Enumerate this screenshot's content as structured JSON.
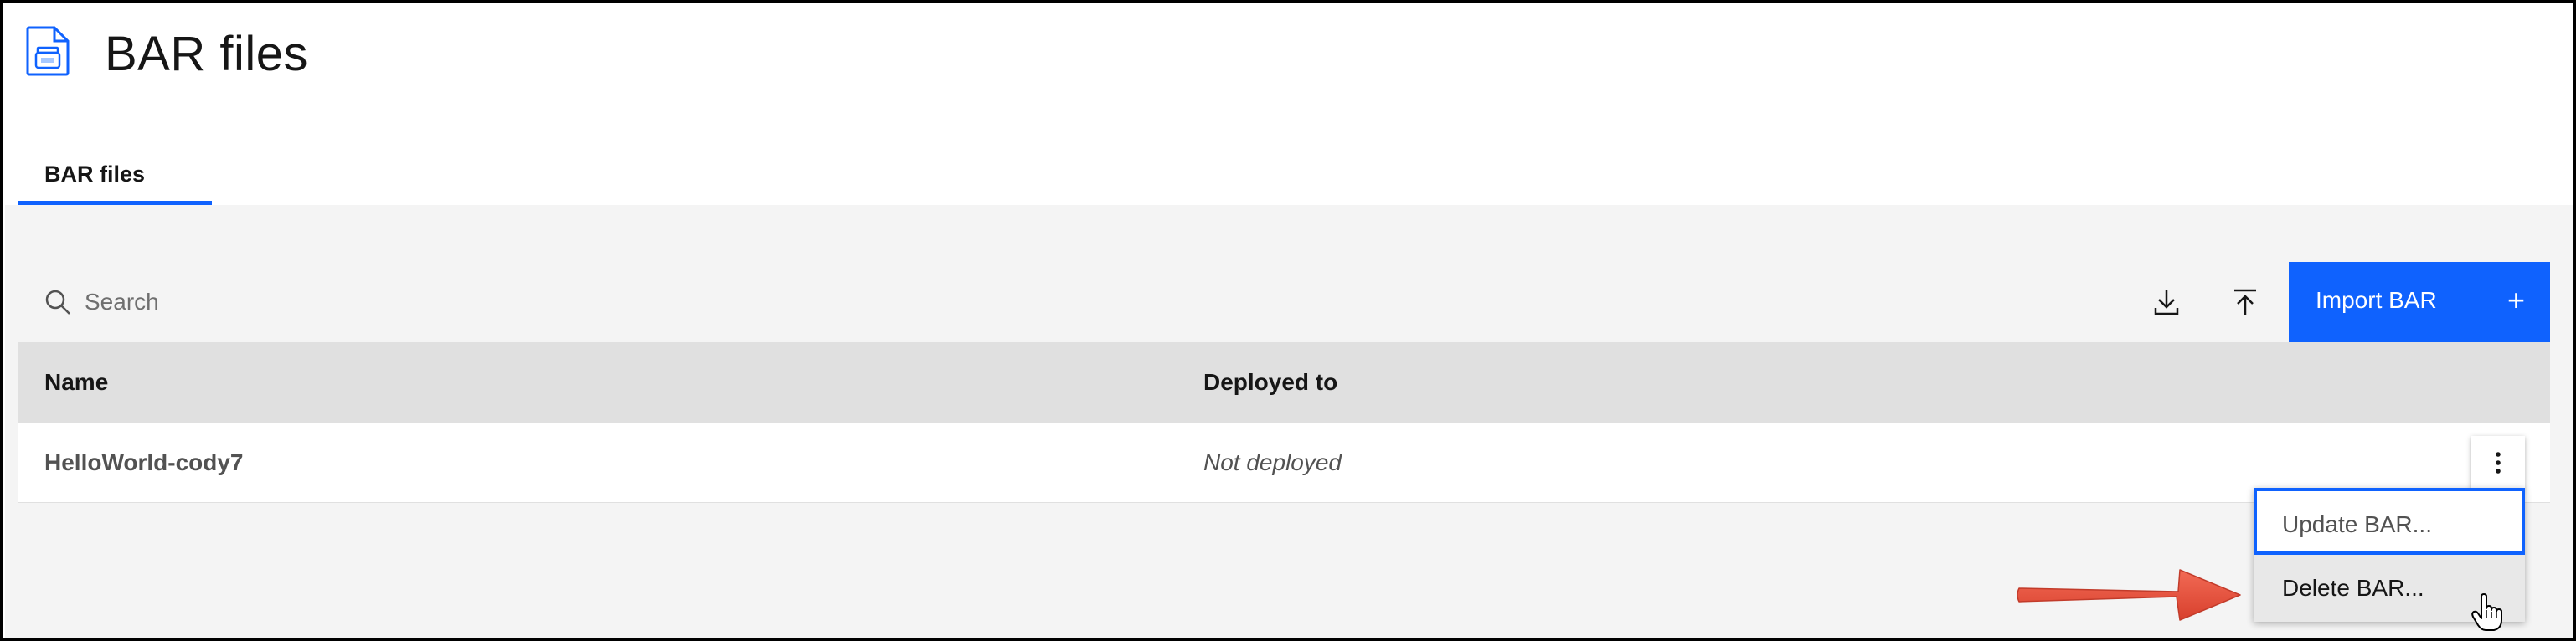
{
  "page": {
    "title": "BAR files",
    "icon": "bar-file-icon"
  },
  "tabs": [
    {
      "label": "BAR files",
      "selected": true
    }
  ],
  "toolbar": {
    "search_placeholder": "Search",
    "search_value": "",
    "download_icon": "download-icon",
    "upload_icon": "upload-icon",
    "import_label": "Import BAR",
    "import_icon": "+"
  },
  "table": {
    "columns": [
      "Name",
      "Deployed to"
    ],
    "rows": [
      {
        "name": "HelloWorld-cody7",
        "deployed_to": "Not deployed"
      }
    ]
  },
  "overflow_menu": {
    "items": [
      "Update BAR...",
      "Delete BAR..."
    ],
    "focused_item": "Update BAR...",
    "hovered_item": "Delete BAR..."
  },
  "annotation": {
    "arrow_color": "#ee4e3e",
    "points_to": "Delete BAR..."
  },
  "colors": {
    "accent": "#0f62fe",
    "workspace_bg": "#f4f4f4",
    "header_bg": "#e0e0e0"
  }
}
